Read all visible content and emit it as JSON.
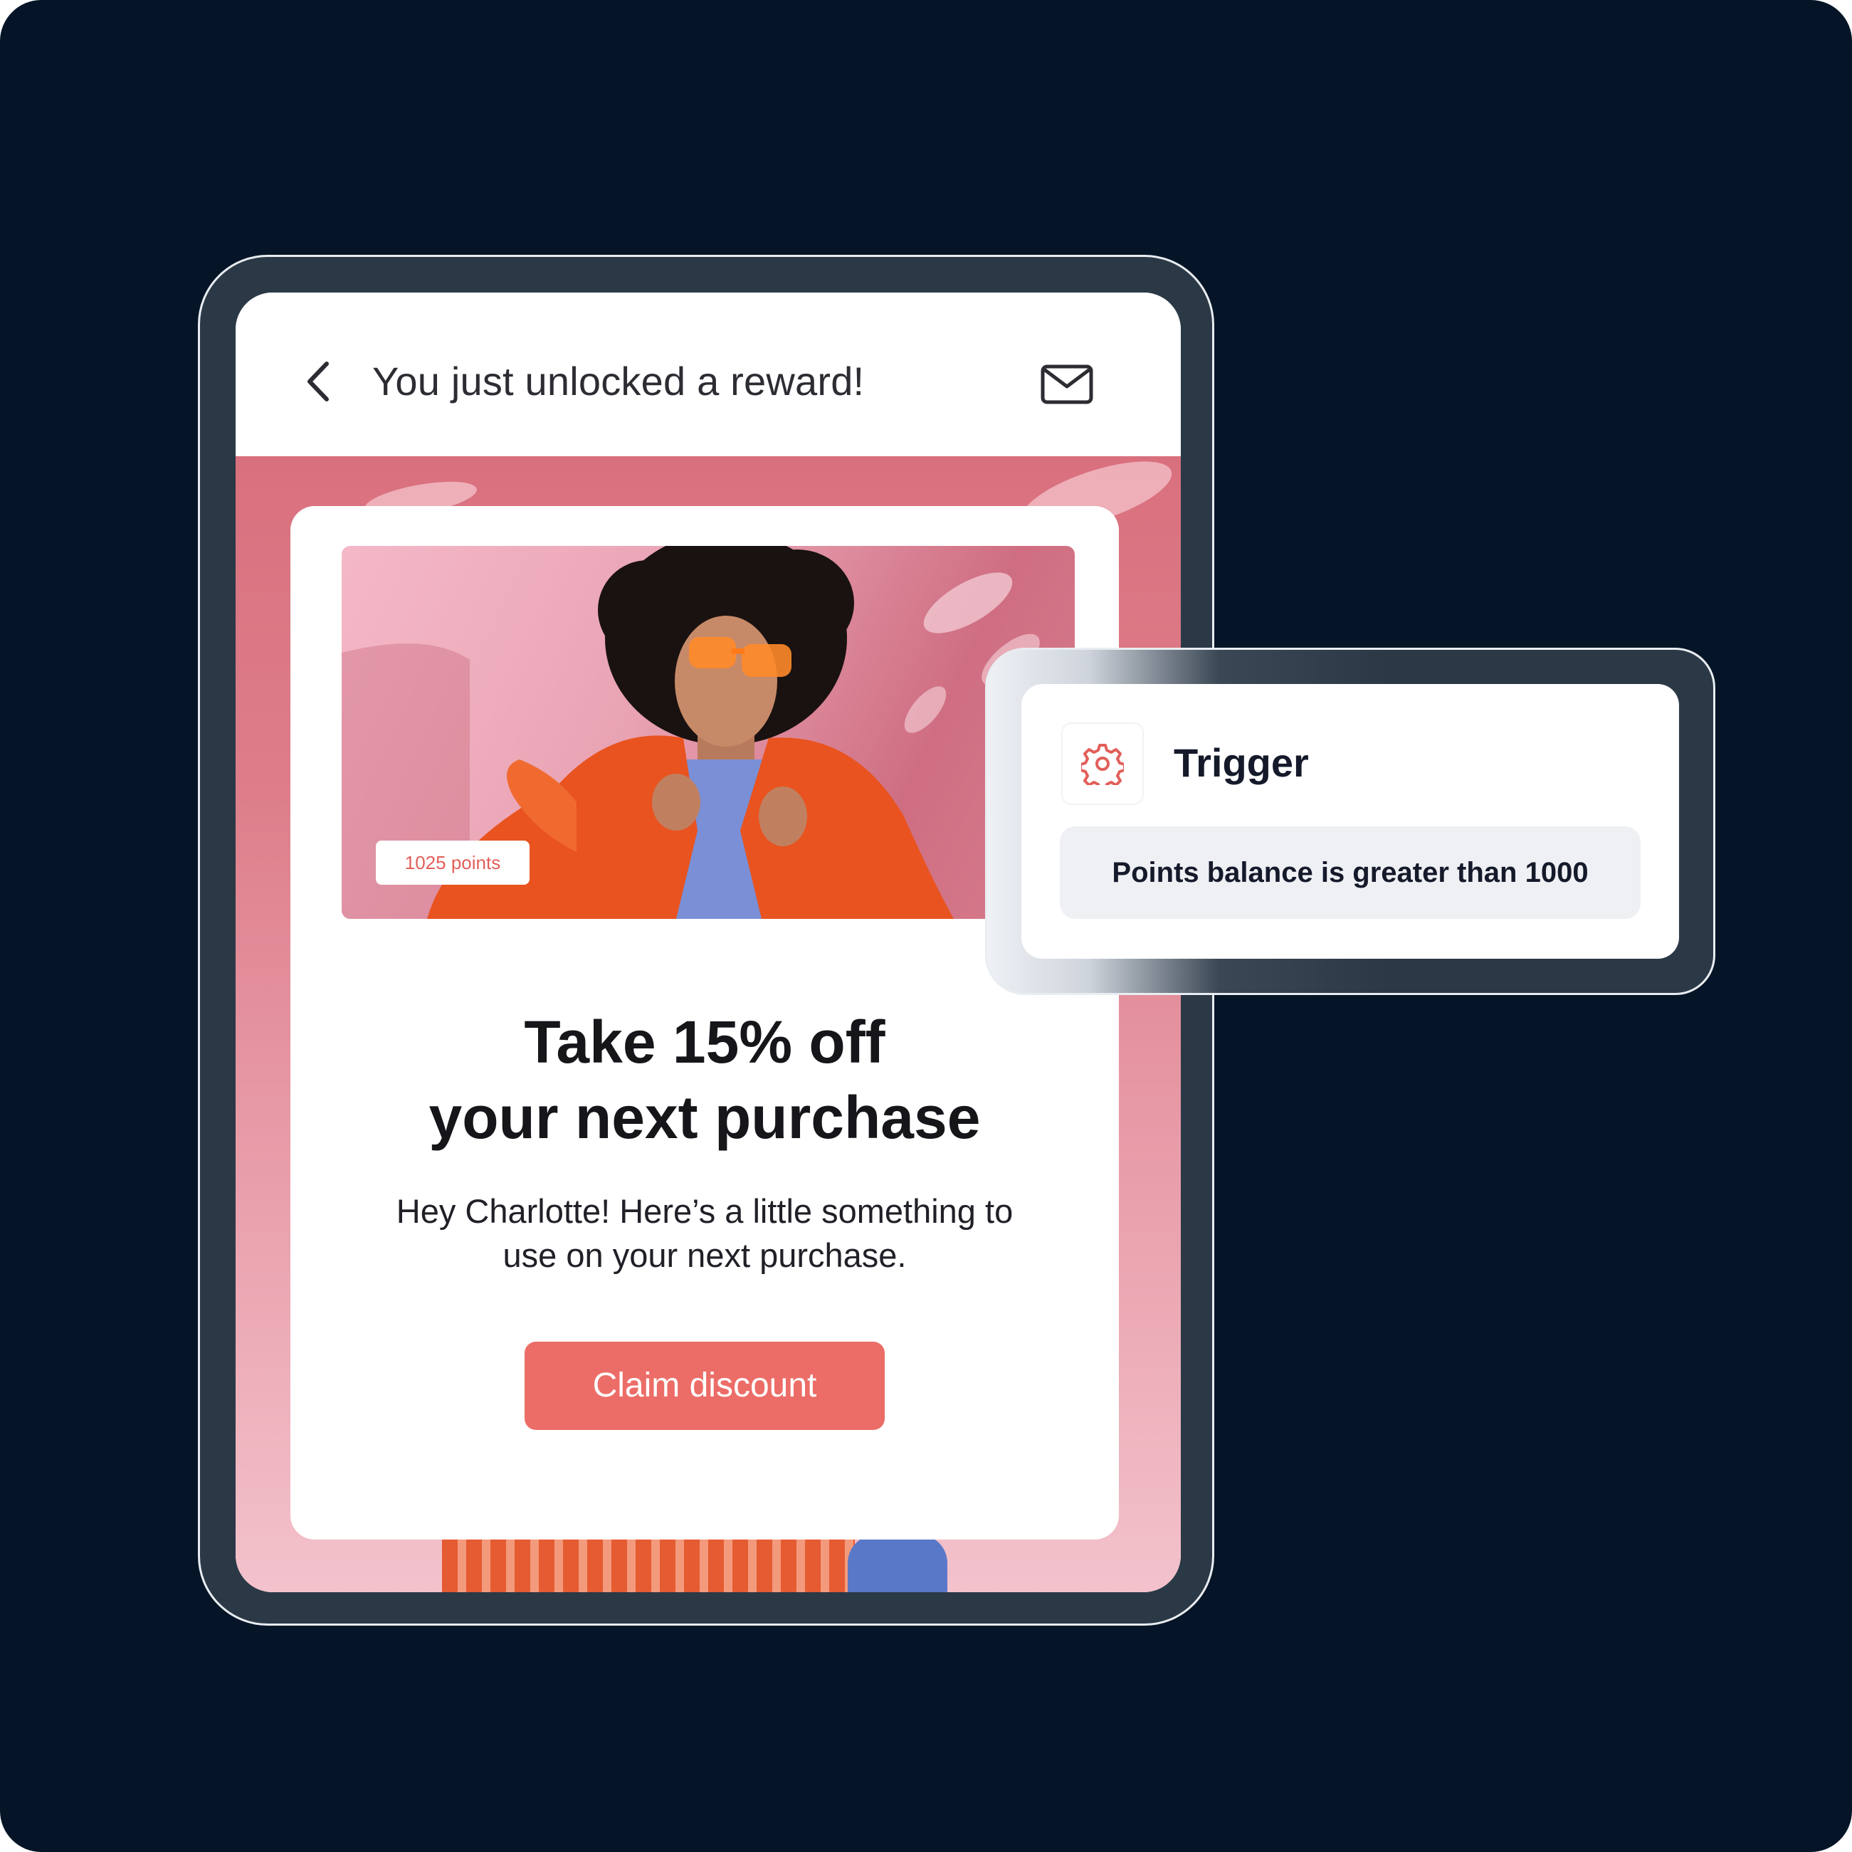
{
  "header": {
    "title": "You just unlocked a reward!",
    "back_icon": "chevron-left-icon",
    "mail_icon": "mail-icon"
  },
  "reward_card": {
    "points_badge": "1025 points",
    "headline_line1": "Take 15% off",
    "headline_line2": "your next purchase",
    "body_line1": "Hey Charlotte! Here’s a little something to",
    "body_line2": "use on your next purchase.",
    "cta_label": "Claim discount"
  },
  "trigger": {
    "icon": "gear-icon",
    "title": "Trigger",
    "condition": "Points balance is greater than 1000"
  },
  "colors": {
    "background": "#051527",
    "device_frame": "#2b3947",
    "accent": "#ec6d67",
    "backdrop_pink": "#de7e8b"
  }
}
